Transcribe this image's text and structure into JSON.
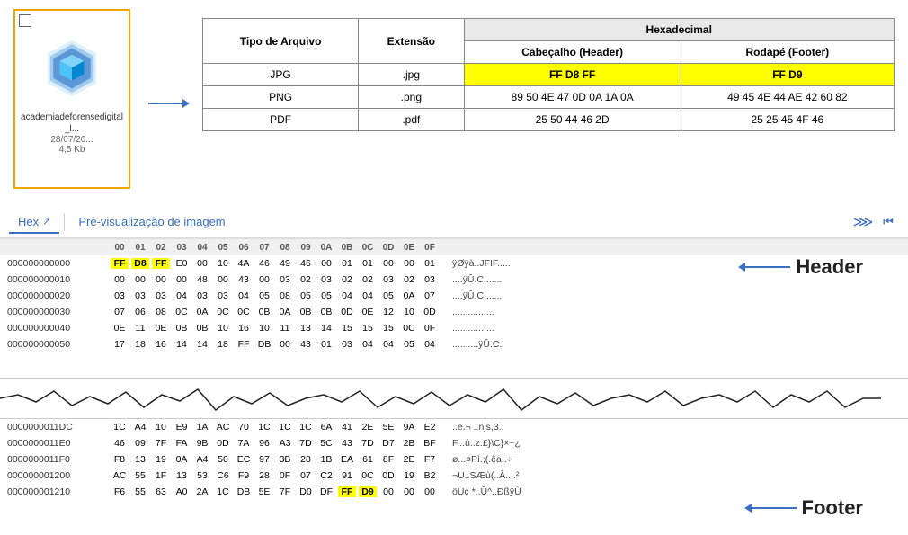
{
  "file": {
    "name": "academiadeforensedigital_l...",
    "date": "28/07/20...",
    "size": "4,5 Kb",
    "checkbox_checked": false
  },
  "table": {
    "hex_group_header": "Hexadecimal",
    "columns": [
      "Tipo de Arquivo",
      "Extensão",
      "Cabeçalho (Header)",
      "Rodapé (Footer)"
    ],
    "rows": [
      {
        "type": "JPG",
        "ext": ".jpg",
        "header": "FF D8 FF",
        "footer": "FF D9",
        "header_hl": true,
        "footer_hl": true
      },
      {
        "type": "PNG",
        "ext": ".png",
        "header": "89 50 4E 47 0D 0A 1A 0A",
        "footer": "49 45 4E 44 AE 42 60 82",
        "header_hl": false,
        "footer_hl": false
      },
      {
        "type": "PDF",
        "ext": ".pdf",
        "header": "25 50 44 46 2D",
        "footer": "25 25 45 4F 46",
        "header_hl": false,
        "footer_hl": false
      }
    ]
  },
  "tabs": {
    "items": [
      {
        "label": "Hex",
        "active": true
      },
      {
        "label": "Pré-visualização de imagem",
        "active": false
      }
    ]
  },
  "hex_header_row": {
    "addr": "",
    "bytes": [
      "00",
      "01",
      "02",
      "03",
      "04",
      "05",
      "06",
      "07",
      "08",
      "09",
      "0A",
      "0B",
      "0C",
      "0D",
      "0E",
      "0F"
    ]
  },
  "hex_top_rows": [
    {
      "addr": "000000000000",
      "bytes": [
        "FF",
        "D8",
        "FF",
        "E0",
        "00",
        "10",
        "4A",
        "46",
        "49",
        "46",
        "00",
        "01",
        "01",
        "00",
        "00",
        "01"
      ],
      "highlight": [
        0,
        1,
        2
      ],
      "ascii": "ÿØÿà..JFIF....."
    },
    {
      "addr": "000000000010",
      "bytes": [
        "00",
        "00",
        "00",
        "00",
        "48",
        "00",
        "43",
        "00",
        "03",
        "02",
        "03",
        "02",
        "02",
        "03",
        "02",
        "03"
      ],
      "highlight": [],
      "ascii": "....ÿÛ.C......."
    },
    {
      "addr": "000000000020",
      "bytes": [
        "03",
        "03",
        "03",
        "04",
        "03",
        "03",
        "04",
        "05",
        "08",
        "05",
        "05",
        "04",
        "04",
        "05",
        "0A",
        "07"
      ],
      "highlight": [],
      "ascii": "....ÿÛ.C......."
    },
    {
      "addr": "000000000030",
      "bytes": [
        "07",
        "06",
        "08",
        "0C",
        "0A",
        "0C",
        "0C",
        "0B",
        "0A",
        "0B",
        "0B",
        "0D",
        "0E",
        "12",
        "10",
        "0D"
      ],
      "highlight": [],
      "ascii": "................"
    },
    {
      "addr": "000000000040",
      "bytes": [
        "0E",
        "11",
        "0E",
        "0B",
        "0B",
        "10",
        "16",
        "10",
        "11",
        "13",
        "14",
        "15",
        "15",
        "15",
        "0C",
        "0F"
      ],
      "highlight": [],
      "ascii": "................"
    },
    {
      "addr": "000000000050",
      "bytes": [
        "17",
        "18",
        "16",
        "14",
        "14",
        "18",
        "FF",
        "DB",
        "00",
        "43",
        "01",
        "03",
        "04",
        "04",
        "05",
        "04"
      ],
      "highlight": [],
      "ascii": "..........ÿÛ.C."
    }
  ],
  "hex_bottom_rows": [
    {
      "addr": "0000000011DC",
      "bytes": [
        "1C",
        "A4",
        "10",
        "E9",
        "1A",
        "AC",
        "70",
        "1C",
        "1C",
        "1C",
        "6A",
        "41",
        "2E",
        "5E",
        "9A",
        "E2"
      ],
      "highlight": [],
      "ascii": "..e.¬  ..njs,3.."
    },
    {
      "addr": "0000000011E0",
      "bytes": [
        "46",
        "09",
        "7F",
        "FA",
        "9B",
        "0D",
        "7A",
        "96",
        "A3",
        "7D",
        "5C",
        "43",
        "7D",
        "D7",
        "2B",
        "BF"
      ],
      "highlight": [],
      "ascii": "F...ú..z.£}\\C}×+¿"
    },
    {
      "addr": "0000000011F0",
      "bytes": [
        "F8",
        "13",
        "19",
        "0A",
        "A4",
        "50",
        "EC",
        "97",
        "3B",
        "28",
        "1B",
        "EA",
        "61",
        "8F",
        "2E",
        "F7"
      ],
      "highlight": [],
      "ascii": "ø...¤Pì.;(.êa..÷"
    },
    {
      "addr": "000000001200",
      "bytes": [
        "AC",
        "55",
        "1F",
        "13",
        "53",
        "C6",
        "F9",
        "28",
        "0F",
        "07",
        "C2",
        "91",
        "0C",
        "0D",
        "19",
        "B2"
      ],
      "highlight": [],
      "ascii": "¬U..SÆù(..Â....²"
    },
    {
      "addr": "000000001210",
      "bytes": [
        "F6",
        "55",
        "63",
        "A0",
        "2A",
        "1C",
        "DB",
        "5E",
        "7F",
        "D0",
        "DF",
        "FF",
        "D9",
        "00",
        "00",
        "00"
      ],
      "highlight": [
        11,
        12
      ],
      "ascii": "öUc *..Û^..ÐßÿÙ"
    }
  ],
  "annotations": {
    "header_label": "Header",
    "footer_label": "Footer"
  }
}
